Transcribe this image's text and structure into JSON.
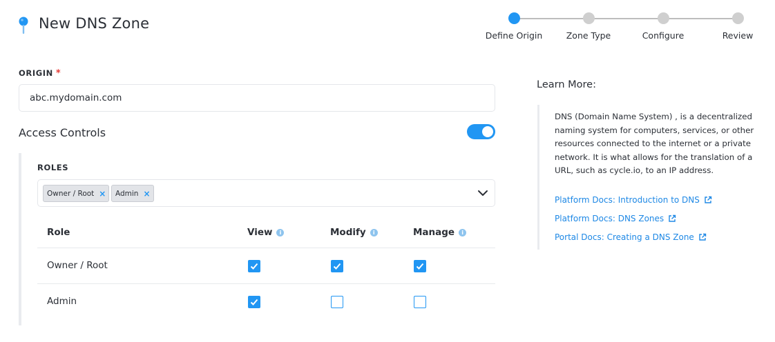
{
  "header": {
    "title": "New DNS Zone",
    "icon": "map-pin-icon"
  },
  "stepper": {
    "steps": [
      {
        "label": "Define Origin",
        "active": true
      },
      {
        "label": "Zone Type",
        "active": false
      },
      {
        "label": "Configure",
        "active": false
      },
      {
        "label": "Review",
        "active": false
      }
    ]
  },
  "origin": {
    "label": "ORIGIN",
    "required_mark": "*",
    "value": "abc.mydomain.com"
  },
  "access_controls": {
    "title": "Access Controls",
    "enabled": true
  },
  "roles": {
    "label": "ROLES",
    "chips": [
      {
        "label": "Owner / Root",
        "remove": "×"
      },
      {
        "label": "Admin",
        "remove": "×"
      }
    ]
  },
  "permissions_table": {
    "headers": {
      "role": "Role",
      "view": "View",
      "modify": "Modify",
      "manage": "Manage",
      "info": "i"
    },
    "rows": [
      {
        "role": "Owner / Root",
        "view": true,
        "modify": true,
        "manage": true
      },
      {
        "role": "Admin",
        "view": true,
        "modify": false,
        "manage": false
      }
    ]
  },
  "learn_more": {
    "title": "Learn More:",
    "description": "DNS (Domain Name System) , is a decentralized naming system for computers, services, or other resources connected to the internet or a private network. It is what allows for the translation of a URL, such as cycle.io, to an IP address.",
    "links": [
      {
        "label": "Platform Docs: Introduction to DNS"
      },
      {
        "label": "Platform Docs: DNS Zones"
      },
      {
        "label": "Portal Docs: Creating a DNS Zone"
      }
    ]
  },
  "colors": {
    "accent": "#2196f3",
    "required": "#e53935",
    "link": "#1e88e5"
  }
}
